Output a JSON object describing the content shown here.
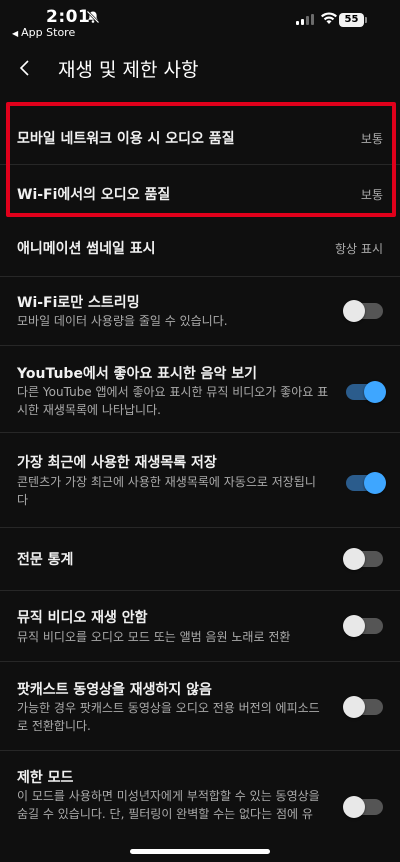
{
  "status_bar": {
    "time": "2:01",
    "back_app": "App Store",
    "battery": "55"
  },
  "header": {
    "title": "재생 및 제한 사항"
  },
  "settings": [
    {
      "title": "모바일 네트워크 이용 시 오디오 품질",
      "value": "보통"
    },
    {
      "title": "Wi-Fi에서의 오디오 품질",
      "value": "보통"
    },
    {
      "title": "애니메이션 썸네일 표시",
      "value": "항상 표시"
    },
    {
      "title": "Wi-Fi로만 스트리밍",
      "subtitle": "모바일 데이터 사용량을 줄일 수 있습니다.",
      "enabled": false
    },
    {
      "title": "YouTube에서 좋아요 표시한 음악 보기",
      "subtitle_line1": "다른 YouTube 앱에서 좋아요 표시한 뮤직 비디오가 좋아요 표",
      "subtitle_line2": "시한 재생목록에 나타납니다.",
      "enabled": true
    },
    {
      "title": "가장 최근에 사용한 재생목록 저장",
      "subtitle_line1": "콘텐츠가 가장 최근에 사용한 재생목록에 자동으로 저장됩니",
      "subtitle_line2": "다",
      "enabled": true
    },
    {
      "title": "전문 통계",
      "enabled": false
    },
    {
      "title": "뮤직 비디오 재생 안함",
      "subtitle": "뮤직 비디오를 오디오 모드 또는 앨범 음원 노래로 전환",
      "enabled": false
    },
    {
      "title": "팟캐스트 동영상을 재생하지 않음",
      "subtitle_line1": "가능한 경우 팟캐스트 동영상을 오디오 전용 버전의 에피소드",
      "subtitle_line2": "로 전환합니다.",
      "enabled": false
    },
    {
      "title": "제한 모드",
      "subtitle_line1": "이 모드를 사용하면 미성년자에게 부적합할 수 있는 동영상을",
      "subtitle_line2": "숨길 수 있습니다. 단, 필터링이 완벽할 수는 없다는 점에 유",
      "enabled": false
    }
  ],
  "colors": {
    "background": "#0f0f0f",
    "highlight": "#e0001b",
    "toggle_on": "#3ea6ff"
  }
}
